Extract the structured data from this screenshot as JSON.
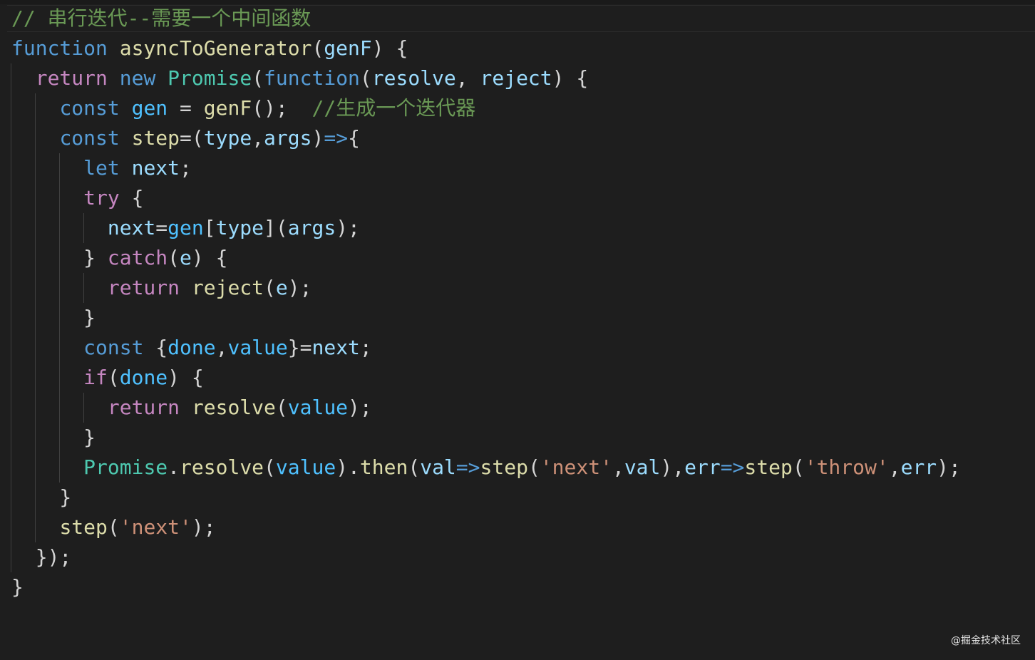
{
  "editor": {
    "lines": [
      [
        {
          "t": "// 串行迭代--需要一个中间函数",
          "c": "#6a9955"
        }
      ],
      [
        {
          "t": "function",
          "c": "#569cd6"
        },
        {
          "t": " ",
          "c": "#d4d4d4"
        },
        {
          "t": "asyncToGenerator",
          "c": "#dcdcaa"
        },
        {
          "t": "(",
          "c": "#d4d4d4"
        },
        {
          "t": "genF",
          "c": "#9cdcfe"
        },
        {
          "t": ") {",
          "c": "#d4d4d4"
        }
      ],
      [
        {
          "t": "  ",
          "c": "#d4d4d4"
        },
        {
          "t": "return",
          "c": "#c586c0"
        },
        {
          "t": " ",
          "c": "#d4d4d4"
        },
        {
          "t": "new",
          "c": "#569cd6"
        },
        {
          "t": " ",
          "c": "#d4d4d4"
        },
        {
          "t": "Promise",
          "c": "#4ec9b0"
        },
        {
          "t": "(",
          "c": "#d4d4d4"
        },
        {
          "t": "function",
          "c": "#569cd6"
        },
        {
          "t": "(",
          "c": "#d4d4d4"
        },
        {
          "t": "resolve",
          "c": "#9cdcfe"
        },
        {
          "t": ", ",
          "c": "#d4d4d4"
        },
        {
          "t": "reject",
          "c": "#9cdcfe"
        },
        {
          "t": ") {",
          "c": "#d4d4d4"
        }
      ],
      [
        {
          "t": "    ",
          "c": "#d4d4d4"
        },
        {
          "t": "const",
          "c": "#569cd6"
        },
        {
          "t": " ",
          "c": "#d4d4d4"
        },
        {
          "t": "gen",
          "c": "#4fc1ff"
        },
        {
          "t": " = ",
          "c": "#d4d4d4"
        },
        {
          "t": "genF",
          "c": "#dcdcaa"
        },
        {
          "t": "();  ",
          "c": "#d4d4d4"
        },
        {
          "t": "//生成一个迭代器",
          "c": "#6a9955"
        }
      ],
      [
        {
          "t": "    ",
          "c": "#d4d4d4"
        },
        {
          "t": "const",
          "c": "#569cd6"
        },
        {
          "t": " ",
          "c": "#d4d4d4"
        },
        {
          "t": "step",
          "c": "#dcdcaa"
        },
        {
          "t": "=(",
          "c": "#d4d4d4"
        },
        {
          "t": "type",
          "c": "#9cdcfe"
        },
        {
          "t": ",",
          "c": "#d4d4d4"
        },
        {
          "t": "args",
          "c": "#9cdcfe"
        },
        {
          "t": ")",
          "c": "#d4d4d4"
        },
        {
          "t": "=>",
          "c": "#569cd6"
        },
        {
          "t": "{",
          "c": "#d4d4d4"
        }
      ],
      [
        {
          "t": "      ",
          "c": "#d4d4d4"
        },
        {
          "t": "let",
          "c": "#569cd6"
        },
        {
          "t": " ",
          "c": "#d4d4d4"
        },
        {
          "t": "next",
          "c": "#9cdcfe"
        },
        {
          "t": ";",
          "c": "#d4d4d4"
        }
      ],
      [
        {
          "t": "      ",
          "c": "#d4d4d4"
        },
        {
          "t": "try",
          "c": "#c586c0"
        },
        {
          "t": " {",
          "c": "#d4d4d4"
        }
      ],
      [
        {
          "t": "        ",
          "c": "#d4d4d4"
        },
        {
          "t": "next",
          "c": "#9cdcfe"
        },
        {
          "t": "=",
          "c": "#d4d4d4"
        },
        {
          "t": "gen",
          "c": "#4fc1ff"
        },
        {
          "t": "[",
          "c": "#d4d4d4"
        },
        {
          "t": "type",
          "c": "#9cdcfe"
        },
        {
          "t": "](",
          "c": "#d4d4d4"
        },
        {
          "t": "args",
          "c": "#9cdcfe"
        },
        {
          "t": ");",
          "c": "#d4d4d4"
        }
      ],
      [
        {
          "t": "      } ",
          "c": "#d4d4d4"
        },
        {
          "t": "catch",
          "c": "#c586c0"
        },
        {
          "t": "(",
          "c": "#d4d4d4"
        },
        {
          "t": "e",
          "c": "#9cdcfe"
        },
        {
          "t": ") {",
          "c": "#d4d4d4"
        }
      ],
      [
        {
          "t": "        ",
          "c": "#d4d4d4"
        },
        {
          "t": "return",
          "c": "#c586c0"
        },
        {
          "t": " ",
          "c": "#d4d4d4"
        },
        {
          "t": "reject",
          "c": "#dcdcaa"
        },
        {
          "t": "(",
          "c": "#d4d4d4"
        },
        {
          "t": "e",
          "c": "#9cdcfe"
        },
        {
          "t": ");",
          "c": "#d4d4d4"
        }
      ],
      [
        {
          "t": "      }",
          "c": "#d4d4d4"
        }
      ],
      [
        {
          "t": "      ",
          "c": "#d4d4d4"
        },
        {
          "t": "const",
          "c": "#569cd6"
        },
        {
          "t": " {",
          "c": "#d4d4d4"
        },
        {
          "t": "done",
          "c": "#4fc1ff"
        },
        {
          "t": ",",
          "c": "#d4d4d4"
        },
        {
          "t": "value",
          "c": "#4fc1ff"
        },
        {
          "t": "}=",
          "c": "#d4d4d4"
        },
        {
          "t": "next",
          "c": "#9cdcfe"
        },
        {
          "t": ";",
          "c": "#d4d4d4"
        }
      ],
      [
        {
          "t": "      ",
          "c": "#d4d4d4"
        },
        {
          "t": "if",
          "c": "#c586c0"
        },
        {
          "t": "(",
          "c": "#d4d4d4"
        },
        {
          "t": "done",
          "c": "#4fc1ff"
        },
        {
          "t": ") {",
          "c": "#d4d4d4"
        }
      ],
      [
        {
          "t": "        ",
          "c": "#d4d4d4"
        },
        {
          "t": "return",
          "c": "#c586c0"
        },
        {
          "t": " ",
          "c": "#d4d4d4"
        },
        {
          "t": "resolve",
          "c": "#dcdcaa"
        },
        {
          "t": "(",
          "c": "#d4d4d4"
        },
        {
          "t": "value",
          "c": "#4fc1ff"
        },
        {
          "t": ");",
          "c": "#d4d4d4"
        }
      ],
      [
        {
          "t": "      }",
          "c": "#d4d4d4"
        }
      ],
      [
        {
          "t": "      ",
          "c": "#d4d4d4"
        },
        {
          "t": "Promise",
          "c": "#4ec9b0"
        },
        {
          "t": ".",
          "c": "#d4d4d4"
        },
        {
          "t": "resolve",
          "c": "#dcdcaa"
        },
        {
          "t": "(",
          "c": "#d4d4d4"
        },
        {
          "t": "value",
          "c": "#4fc1ff"
        },
        {
          "t": ").",
          "c": "#d4d4d4"
        },
        {
          "t": "then",
          "c": "#dcdcaa"
        },
        {
          "t": "(",
          "c": "#d4d4d4"
        },
        {
          "t": "val",
          "c": "#9cdcfe"
        },
        {
          "t": "=>",
          "c": "#569cd6"
        },
        {
          "t": "step",
          "c": "#dcdcaa"
        },
        {
          "t": "(",
          "c": "#d4d4d4"
        },
        {
          "t": "'next'",
          "c": "#ce9178"
        },
        {
          "t": ",",
          "c": "#d4d4d4"
        },
        {
          "t": "val",
          "c": "#9cdcfe"
        },
        {
          "t": "),",
          "c": "#d4d4d4"
        },
        {
          "t": "err",
          "c": "#9cdcfe"
        },
        {
          "t": "=>",
          "c": "#569cd6"
        },
        {
          "t": "step",
          "c": "#dcdcaa"
        },
        {
          "t": "(",
          "c": "#d4d4d4"
        },
        {
          "t": "'throw'",
          "c": "#ce9178"
        },
        {
          "t": ",",
          "c": "#d4d4d4"
        },
        {
          "t": "err",
          "c": "#9cdcfe"
        },
        {
          "t": ");",
          "c": "#d4d4d4"
        }
      ],
      [
        {
          "t": "    }",
          "c": "#d4d4d4"
        }
      ],
      [
        {
          "t": "    ",
          "c": "#d4d4d4"
        },
        {
          "t": "step",
          "c": "#dcdcaa"
        },
        {
          "t": "(",
          "c": "#d4d4d4"
        },
        {
          "t": "'next'",
          "c": "#ce9178"
        },
        {
          "t": ");",
          "c": "#d4d4d4"
        }
      ],
      [
        {
          "t": "  });",
          "c": "#d4d4d4"
        }
      ],
      [
        {
          "t": "}",
          "c": "#d4d4d4"
        }
      ]
    ]
  },
  "watermark": {
    "text": "@掘金技术社区"
  }
}
